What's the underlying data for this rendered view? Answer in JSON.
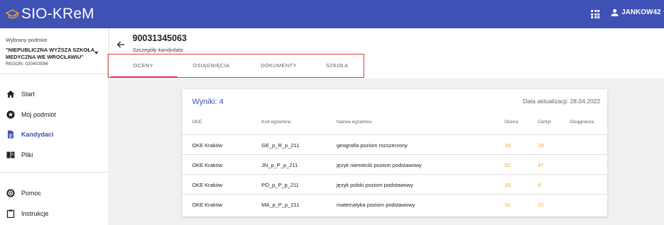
{
  "app": {
    "brand": "SIO-KReM",
    "user": "JANKOW42",
    "colors": {
      "primary": "#3f51b5",
      "accent_tab": "#e91e63",
      "highlight_box": "#e53935",
      "score": "#f5a623"
    },
    "icons": {
      "logo": "graduation-cap-icon",
      "apps": "apps-grid-icon",
      "user": "person-icon",
      "back": "arrow-back-icon"
    }
  },
  "sidebar": {
    "entity_label": "Wybrany podmiot",
    "entity_name": "\"NIEPUBLICZNA WYŻSZA SZKOŁA MEDYCZNA WE WROCŁAWIU\"",
    "regon": "REGON: 020403596",
    "items": [
      {
        "label": "Start",
        "icon": "home-icon"
      },
      {
        "label": "Mój podmiot",
        "icon": "star-circle-icon"
      },
      {
        "label": "Kandydaci",
        "icon": "document-icon"
      },
      {
        "label": "Pliki",
        "icon": "book-icon"
      },
      {
        "label": "Pomoc",
        "icon": "help-lifebuoy-icon"
      },
      {
        "label": "Instrukcje",
        "icon": "clipboard-icon"
      }
    ]
  },
  "candidate": {
    "id": "90031345063",
    "subtitle": "Szczegóły kandydata"
  },
  "tabs": [
    {
      "label": "OCENY"
    },
    {
      "label": "OSIĄGNIĘCIA"
    },
    {
      "label": "DOKUMENTY"
    },
    {
      "label": "SZKOŁA"
    }
  ],
  "card": {
    "results_title": "Wyniki: 4",
    "update_date": "Data aktualizacji: 28.04.2022",
    "headers": [
      "OKE",
      "Kod egzaminu",
      "Nazwa egzaminu",
      "Ocena",
      "Centyl",
      "Osiągniecia"
    ],
    "rows": [
      {
        "oke": "OKE Kraków",
        "code": "GE_p_R_p_211",
        "name": "geografia poziom rozszerzony",
        "grade": "18",
        "centile": "28"
      },
      {
        "oke": "OKE Kraków",
        "code": "JN_p_P_p_211",
        "name": "język niemiecki poziom podstawowy",
        "grade": "52",
        "centile": "47"
      },
      {
        "oke": "OKE Kraków",
        "code": "PO_p_P_p_211",
        "name": "język polski poziom podstawowy",
        "grade": "33",
        "centile": "9"
      },
      {
        "oke": "OKE Kraków",
        "code": "MA_p_P_p_211",
        "name": "matematyka poziom podstawowy",
        "grade": "31",
        "centile": "22"
      }
    ]
  }
}
